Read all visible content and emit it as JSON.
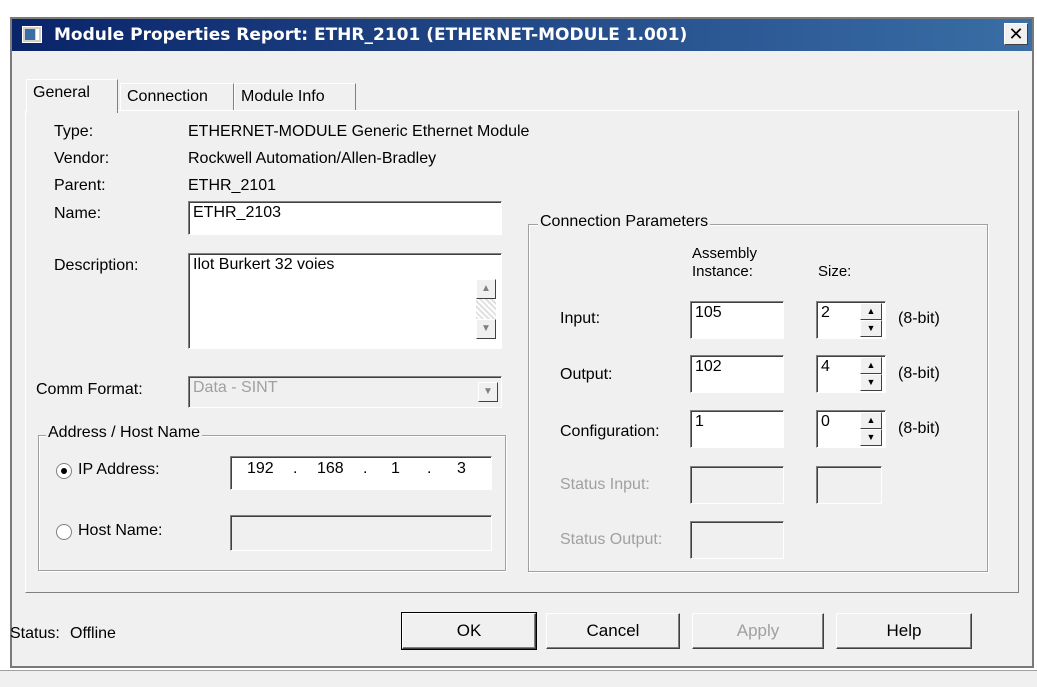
{
  "window": {
    "title": "Module Properties Report: ETHR_2101 (ETHERNET-MODULE 1.001)",
    "close_glyph": "✕"
  },
  "tabs": [
    {
      "label": "General"
    },
    {
      "label": "Connection"
    },
    {
      "label": "Module Info"
    }
  ],
  "general": {
    "type_label": "Type:",
    "type_value": "ETHERNET-MODULE Generic Ethernet Module",
    "vendor_label": "Vendor:",
    "vendor_value": "Rockwell Automation/Allen-Bradley",
    "parent_label": "Parent:",
    "parent_value": "ETHR_2101",
    "name_label": "Name:",
    "name_value": "ETHR_2103",
    "description_label": "Description:",
    "description_value": "Ilot Burkert 32 voies",
    "comm_format_label": "Comm Format:",
    "comm_format_value": "Data - SINT"
  },
  "address": {
    "group_title": "Address / Host Name",
    "ip_label": "IP Address:",
    "ip_octets": [
      "192",
      "168",
      "1",
      "3"
    ],
    "ip_separator": ".",
    "host_label": "Host Name:",
    "host_value": "",
    "selected": "ip"
  },
  "connection": {
    "group_title": "Connection Parameters",
    "col_assembly_line1": "Assembly",
    "col_assembly_line2": "Instance:",
    "col_size": "Size:",
    "rows": [
      {
        "label": "Input:",
        "instance": "105",
        "size": "2",
        "unit": "(8-bit)"
      },
      {
        "label": "Output:",
        "instance": "102",
        "size": "4",
        "unit": "(8-bit)"
      },
      {
        "label": "Configuration:",
        "instance": "1",
        "size": "0",
        "unit": "(8-bit)"
      }
    ],
    "status_input_label": "Status Input:",
    "status_output_label": "Status Output:"
  },
  "footer": {
    "status_label": "Status:",
    "status_value": "Offline",
    "ok": "OK",
    "cancel": "Cancel",
    "apply": "Apply",
    "help": "Help"
  }
}
